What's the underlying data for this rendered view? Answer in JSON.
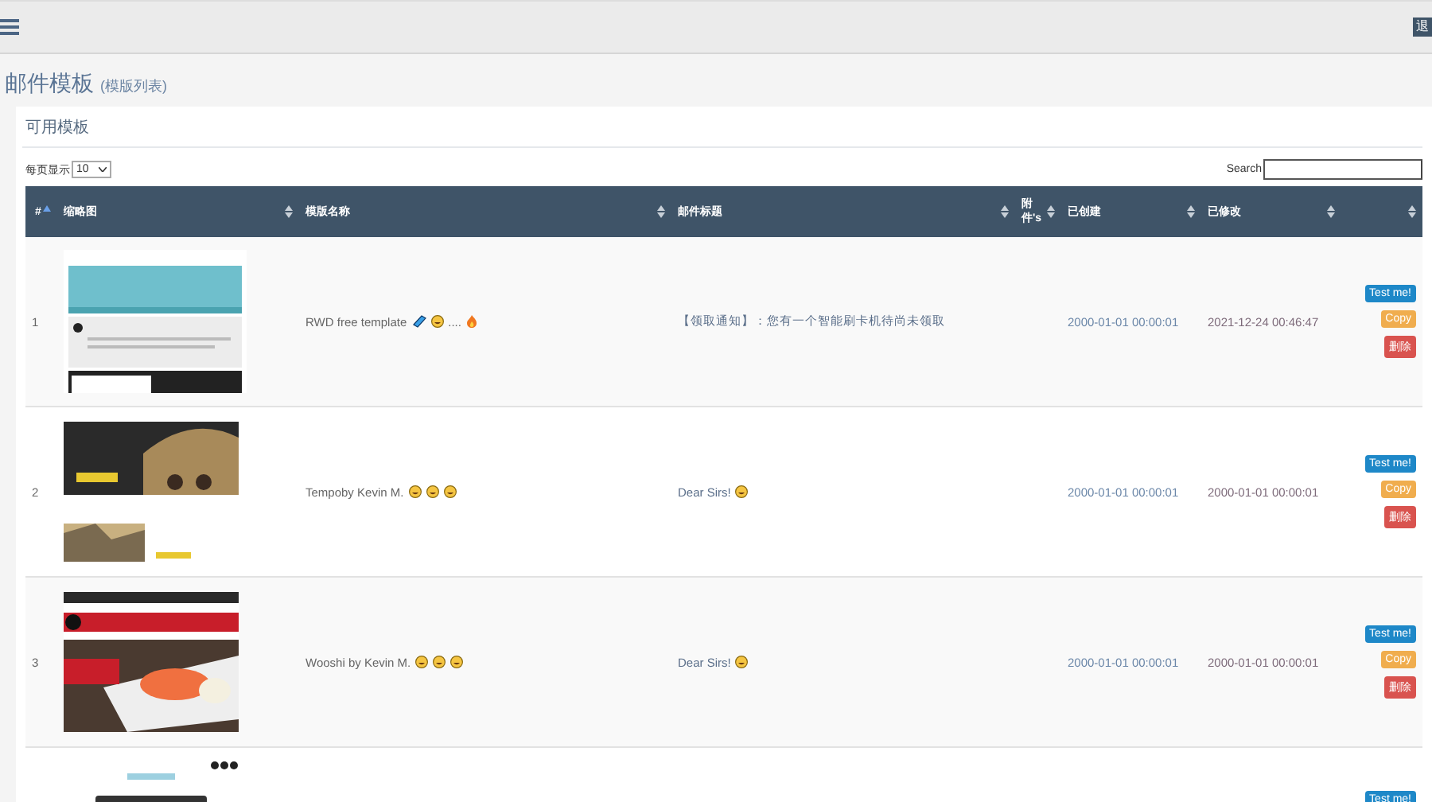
{
  "header": {
    "logout": "退"
  },
  "page": {
    "title": "邮件模板",
    "subtitle": "(模版列表)"
  },
  "card": {
    "title": "可用模板",
    "page_size_label": "每页显示",
    "page_size": "10",
    "search_label": "Search"
  },
  "table": {
    "columns": [
      {
        "label": "#",
        "sorted": true
      },
      {
        "label": "缩略图",
        "sorted": false
      },
      {
        "label": "模版名称",
        "sorted": false
      },
      {
        "label": "邮件标题",
        "sorted": false
      },
      {
        "label": "附件's",
        "sorted": false
      },
      {
        "label": "已创建",
        "sorted": false
      },
      {
        "label": "已修改",
        "sorted": false
      },
      {
        "sorted": false
      }
    ],
    "rows": [
      {
        "num": "1",
        "thumb": {
          "kind": "picture"
        },
        "name": [
          {
            "kind": "text",
            "text": "RWD free template"
          },
          {
            "kind": "gem"
          },
          {
            "kind": "face"
          },
          {
            "kind": "text",
            "text": "...."
          },
          {
            "kind": "fire"
          }
        ],
        "subject": [
          {
            "kind": "text",
            "text": "【领取通知】：您有一个智能刷卡机待尚未领取"
          }
        ],
        "created": "2000-01-01 00:00:01",
        "modified": "2021-12-24 00:46:47",
        "buttons": [
          "Test me!",
          "Copy",
          "删除"
        ]
      },
      {
        "num": "2",
        "thumb": {
          "kind": "picture"
        },
        "name": [
          {
            "kind": "text",
            "text": "Tempoby Kevin M."
          },
          {
            "kind": "face"
          },
          {
            "kind": "face"
          },
          {
            "kind": "face"
          }
        ],
        "subject": [
          {
            "kind": "text",
            "text": "Dear Sirs!"
          },
          {
            "kind": "face"
          }
        ],
        "created": "2000-01-01 00:00:01",
        "modified": "2000-01-01 00:00:01",
        "buttons": [
          "Test me!",
          "Copy",
          "删除"
        ]
      },
      {
        "num": "3",
        "thumb": {
          "kind": "picture"
        },
        "name": [
          {
            "kind": "text",
            "text": "Wooshi by Kevin M."
          },
          {
            "kind": "face"
          },
          {
            "kind": "face"
          },
          {
            "kind": "face"
          }
        ],
        "subject": [
          {
            "kind": "text",
            "text": "Dear Sirs!"
          },
          {
            "kind": "face"
          }
        ],
        "created": "2000-01-01 00:00:01",
        "modified": "2000-01-01 00:00:01",
        "buttons": [
          "Test me!",
          "Copy",
          "删除"
        ]
      },
      {
        "thumb": {
          "kind": "picture"
        },
        "buttons": [
          "Test me!"
        ]
      }
    ]
  }
}
